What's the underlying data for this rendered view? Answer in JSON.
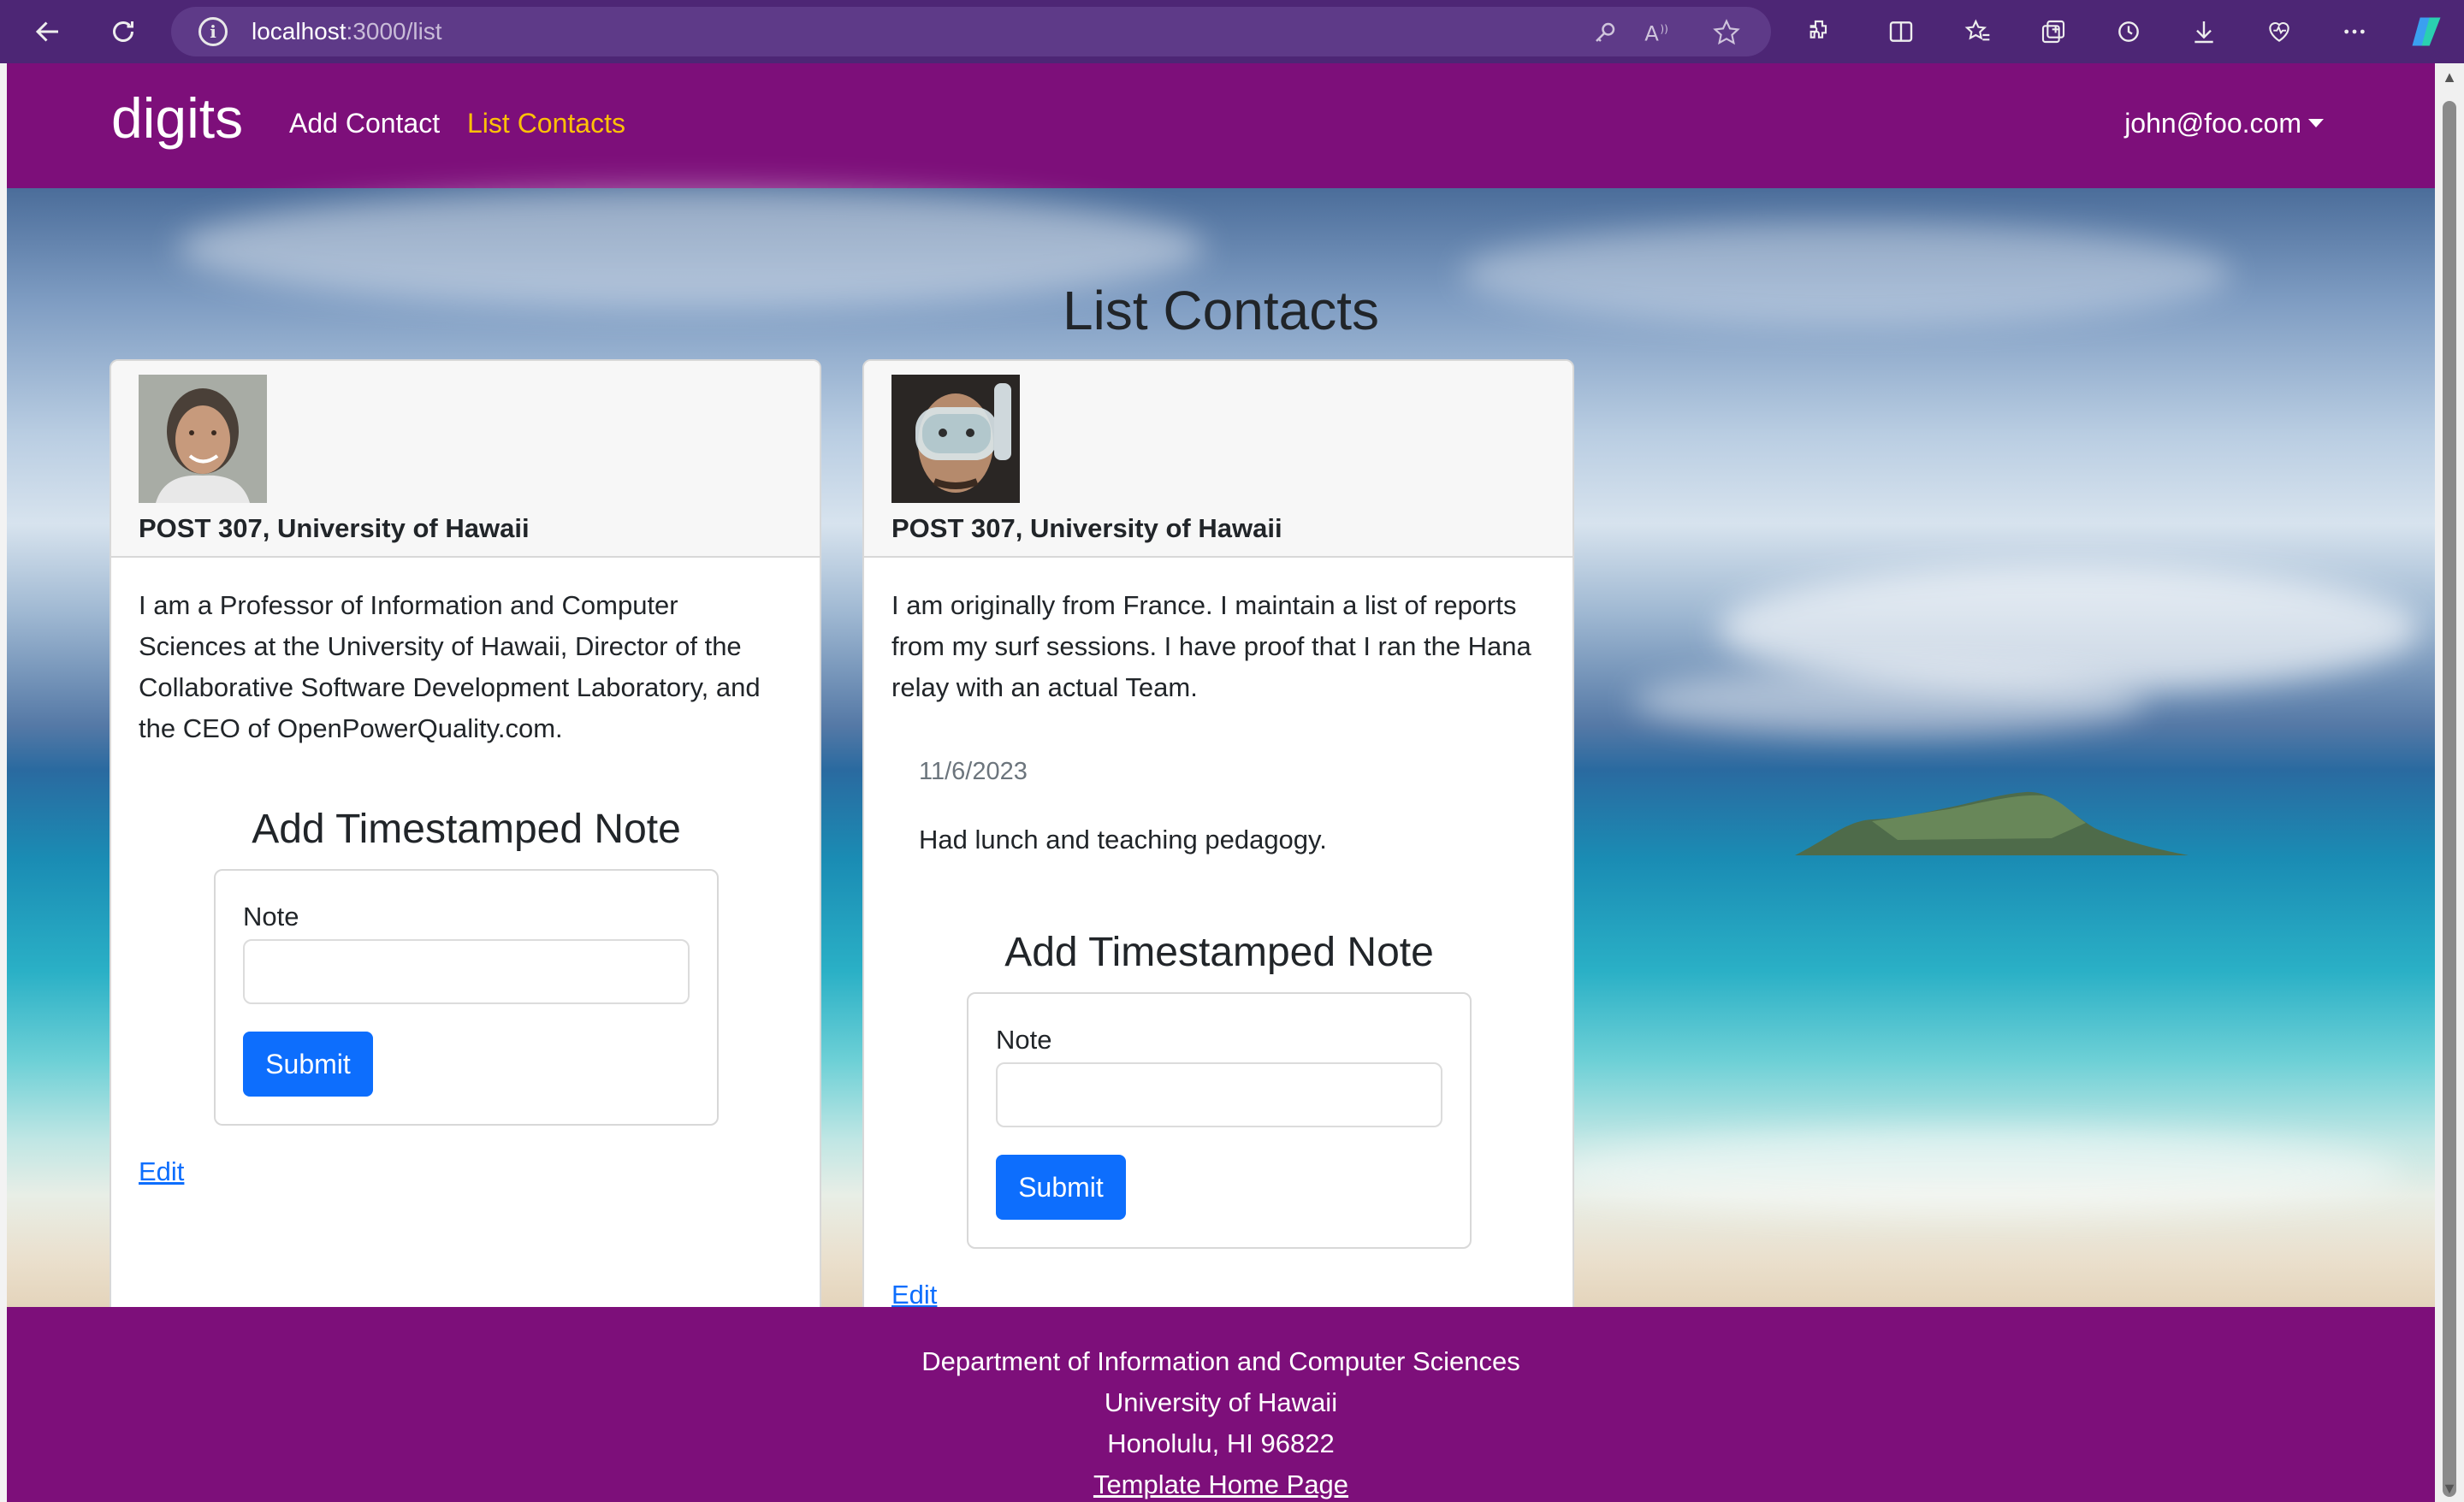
{
  "browser": {
    "url_host": "localhost",
    "url_path": ":3000/list"
  },
  "navbar": {
    "brand": "digits",
    "links": [
      {
        "label": "Add Contact",
        "active": false
      },
      {
        "label": "List Contacts",
        "active": true
      }
    ],
    "user": "john@foo.com"
  },
  "page": {
    "title": "List Contacts"
  },
  "contacts": [
    {
      "address": "POST 307, University of Hawaii",
      "description_lines": [
        "I am a Professor of Information and Computer",
        "Sciences at the University of Hawaii, Director of the",
        "Collaborative Software Development Laboratory, and",
        "the CEO of OpenPowerQuality.com."
      ],
      "notes": [],
      "form_title": "Add Timestamped Note",
      "note_label": "Note",
      "submit_label": "Submit",
      "edit_label": "Edit"
    },
    {
      "address": "POST 307, University of Hawaii",
      "description_lines": [
        "I am originally from France. I maintain a list of reports",
        "from my surf sessions. I have proof that I ran the Hana",
        "relay with an actual Team."
      ],
      "notes": [
        {
          "date": "11/6/2023",
          "text": "Had lunch and teaching pedagogy."
        }
      ],
      "form_title": "Add Timestamped Note",
      "note_label": "Note",
      "submit_label": "Submit",
      "edit_label": "Edit"
    }
  ],
  "footer": {
    "lines": [
      "Department of Information and Computer Sciences",
      "University of Hawaii",
      "Honolulu, HI 96822"
    ],
    "link": "Template Home Page"
  }
}
